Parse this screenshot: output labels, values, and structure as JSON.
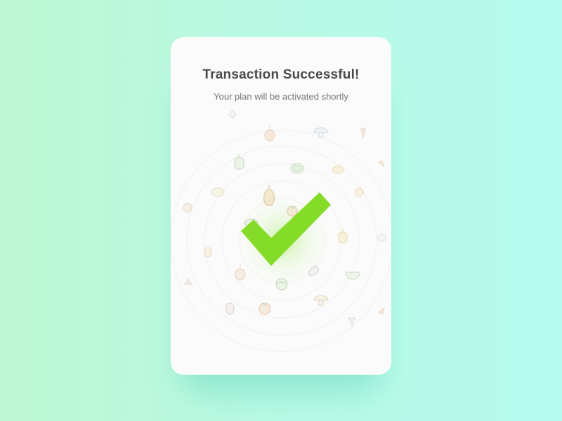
{
  "dialog": {
    "title": "Transaction Successful!",
    "message": "Your plan will be activated shortly"
  },
  "icons": {
    "status": "checkmark-icon",
    "decorations": [
      "onion-icon",
      "cabbage-icon",
      "pear-icon",
      "bell-pepper-icon",
      "tomato-icon",
      "mushroom-icon",
      "eggplant-icon",
      "melon-slice-icon",
      "carrot-icon",
      "apple-icon",
      "lemon-icon"
    ]
  },
  "colors": {
    "background_left": "#bdf7d3",
    "background_right": "#b6fbef",
    "card": "#fbfbfb",
    "check": "#84dc28",
    "title": "#4a4a4a",
    "subtitle": "#757575"
  }
}
